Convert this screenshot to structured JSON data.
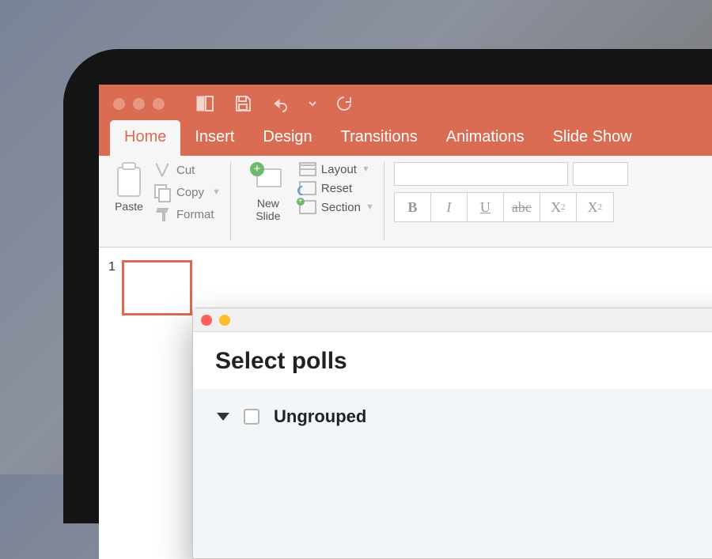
{
  "ribbon_tabs": {
    "home": "Home",
    "insert": "Insert",
    "design": "Design",
    "transitions": "Transitions",
    "animations": "Animations",
    "slideshow": "Slide Show"
  },
  "active_tab": "Home",
  "clipboard": {
    "paste": "Paste",
    "cut": "Cut",
    "copy": "Copy",
    "format": "Format"
  },
  "slides_group": {
    "new_slide": "New\nSlide",
    "layout": "Layout",
    "reset": "Reset",
    "section": "Section"
  },
  "font_buttons": {
    "bold": "B",
    "italic": "I",
    "underline": "U",
    "strike": "abc",
    "super": "X",
    "sub": "X"
  },
  "thumbs": {
    "slide1_number": "1"
  },
  "polls_window": {
    "title": "Select polls",
    "groups": [
      {
        "name": "Ungrouped",
        "checked": false,
        "expanded": true
      }
    ]
  }
}
